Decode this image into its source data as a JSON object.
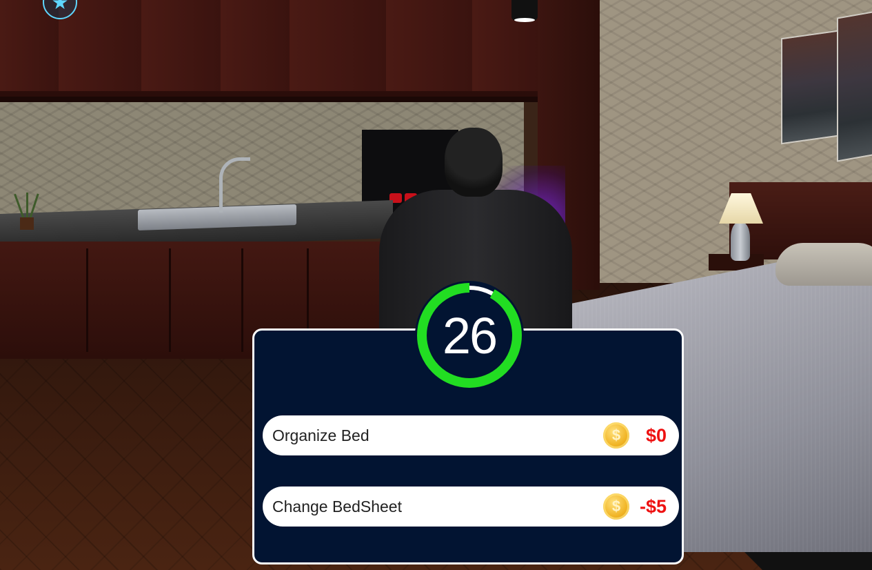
{
  "hud": {
    "star_icon": "star-icon",
    "timer_value": "26",
    "timer_progress": 0.92,
    "timer_color": "#22dd22"
  },
  "task_panel": {
    "options": [
      {
        "label": "Organize Bed",
        "price": "$0",
        "coin_symbol": "$",
        "icon": "coin-icon"
      },
      {
        "label": "Change BedSheet",
        "price": "-$5",
        "coin_symbol": "$",
        "icon": "coin-icon"
      }
    ],
    "colors": {
      "panel_bg": "#021432",
      "price": "#ee1111",
      "coin": "#f0b324"
    }
  }
}
